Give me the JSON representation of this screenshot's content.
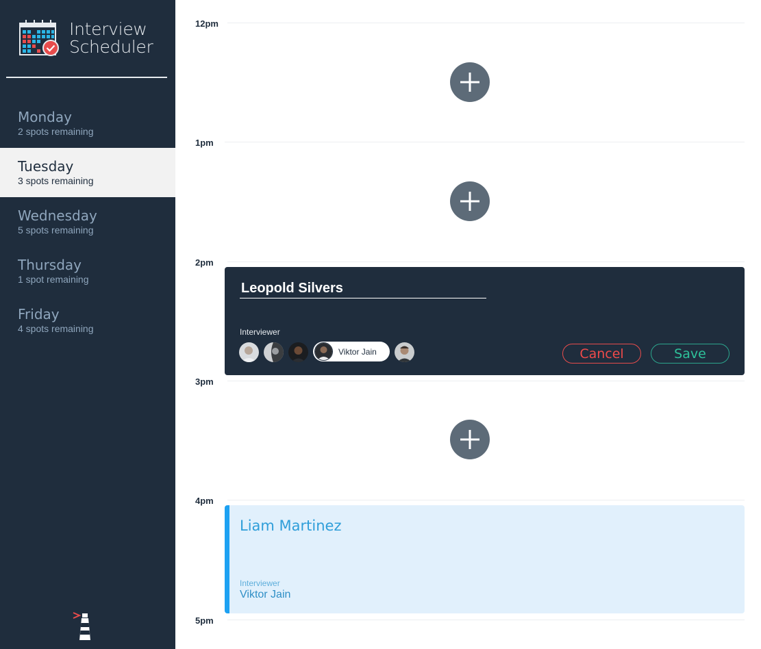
{
  "app": {
    "title_line1": "Interview",
    "title_line2": "Scheduler"
  },
  "sidebar": {
    "days": [
      {
        "name": "Monday",
        "spots": "2 spots remaining",
        "selected": false
      },
      {
        "name": "Tuesday",
        "spots": "3 spots remaining",
        "selected": true
      },
      {
        "name": "Wednesday",
        "spots": "5 spots remaining",
        "selected": false
      },
      {
        "name": "Thursday",
        "spots": "1 spot remaining",
        "selected": false
      },
      {
        "name": "Friday",
        "spots": "4 spots remaining",
        "selected": false
      }
    ]
  },
  "schedule": {
    "times": [
      "12pm",
      "1pm",
      "2pm",
      "3pm",
      "4pm",
      "5pm"
    ],
    "form": {
      "student_name_value": "Leopold Silvers",
      "interviewer_label": "Interviewer",
      "selected_interviewer": "Viktor Jain",
      "cancel_label": "Cancel",
      "save_label": "Save"
    },
    "booked": {
      "student": "Liam Martinez",
      "interviewer_label": "Interviewer",
      "interviewer": "Viktor Jain"
    }
  },
  "colors": {
    "sidebar_bg": "#1f2d3d",
    "accent_blue": "#1da1f2",
    "cancel_red": "#e74c4c",
    "save_green": "#2ca58d"
  }
}
